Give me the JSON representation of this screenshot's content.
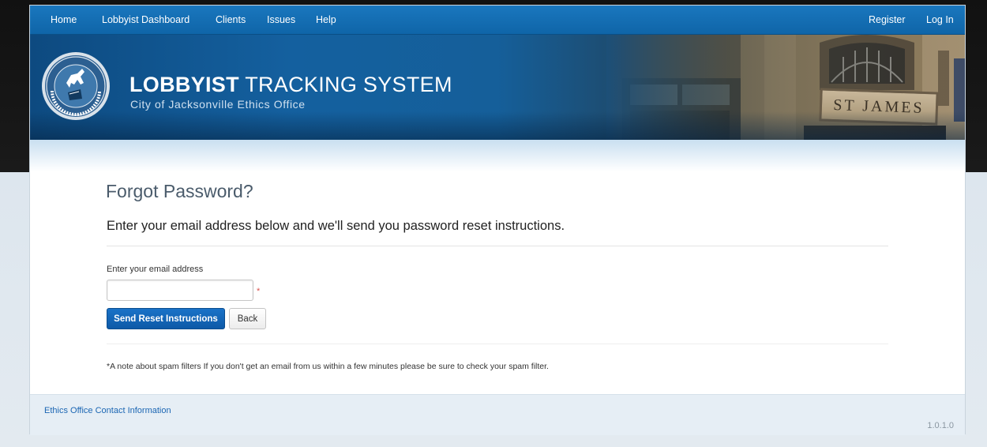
{
  "nav": {
    "left": [
      "Home",
      "Lobbyist Dashboard",
      "Clients",
      "Issues",
      "Help"
    ],
    "right": [
      "Register",
      "Log In"
    ]
  },
  "banner": {
    "title_bold": "LOBBYIST",
    "title_rest": " TRACKING SYSTEM",
    "subtitle": "City of Jacksonville Ethics Office",
    "seal_label": "CITY OF JACKSONVILLE FLORIDA",
    "building_sign": "ST JAMES"
  },
  "page": {
    "title": "Forgot Password?",
    "lead": "Enter your email address below and we'll send you password reset instructions.",
    "email_label": "Enter your email address",
    "email_value": "",
    "required_mark": "*",
    "send_button": "Send Reset Instructions",
    "back_button": "Back",
    "spam_note": "*A note about spam filters If you don't get an email from us within a few minutes please be sure to check your spam filter."
  },
  "footer": {
    "contact_link": "Ethics Office Contact Information",
    "version": "1.0.1.0"
  },
  "colors": {
    "nav_bg": "#1a77be",
    "primary_button": "#1a73c8",
    "link": "#1b66b3"
  }
}
